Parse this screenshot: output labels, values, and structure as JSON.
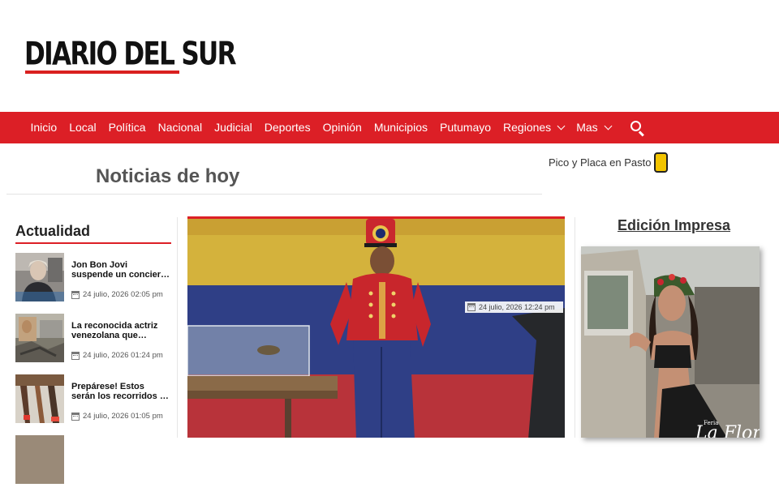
{
  "site": {
    "logo_text": "DIARIO DEL SUR"
  },
  "nav": {
    "items": [
      "Inicio",
      "Local",
      "Política",
      "Nacional",
      "Judicial",
      "Deportes",
      "Opinión",
      "Municipios",
      "Putumayo"
    ],
    "regiones_label": "Regiones",
    "mas_label": "Mas"
  },
  "main": {
    "section_title": "Noticias de hoy",
    "feature_date": "24 julio, 2026 12:24 pm"
  },
  "pico": {
    "label": "Pico y Placa en Pasto"
  },
  "actualidad": {
    "heading": "Actualidad",
    "items": [
      {
        "title": "Jon Bon Jovi suspende un concierto en Nueva…",
        "date": "24 julio, 2026 02:05 pm"
      },
      {
        "title": "La reconocida actriz venezolana que regres…",
        "date": "24 julio, 2026 01:24 pm"
      },
      {
        "title": "Prepárese! Estos serán los recorridos de la…",
        "date": "24 julio, 2026 01:05 pm"
      }
    ]
  },
  "edicion": {
    "title": "Edición Impresa",
    "cover_small": "Feria",
    "cover_brand": "La Florida"
  },
  "colors": {
    "brand_red": "#dc1f26",
    "pico_yellow": "#f2c400"
  }
}
